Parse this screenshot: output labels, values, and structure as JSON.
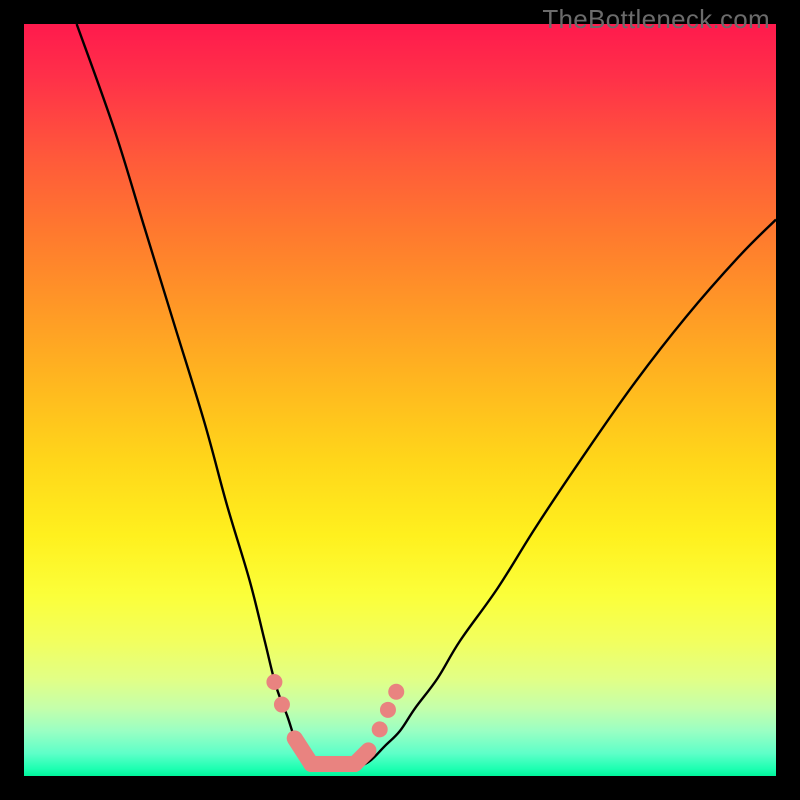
{
  "watermark": "TheBottleneck.com",
  "colors": {
    "gradient_top": "#ff1a4d",
    "gradient_mid": "#ffd61a",
    "gradient_bottom": "#00f59b",
    "curve": "#000000",
    "marker": "#e98380",
    "frame": "#000000"
  },
  "chart_data": {
    "type": "line",
    "title": "",
    "xlabel": "",
    "ylabel": "",
    "xlim": [
      0,
      100
    ],
    "ylim": [
      0,
      100
    ],
    "grid": false,
    "legend": false,
    "series": [
      {
        "name": "left-curve",
        "x": [
          7,
          12,
          16,
          20,
          24,
          27,
          30,
          32,
          33.5,
          35,
          36,
          37,
          38,
          40
        ],
        "y": [
          100,
          86,
          73,
          60,
          47,
          36,
          26,
          18,
          12,
          8,
          5,
          3,
          2,
          1
        ]
      },
      {
        "name": "right-curve",
        "x": [
          44,
          46,
          48,
          50,
          52,
          55,
          58,
          63,
          68,
          74,
          81,
          88,
          95,
          100
        ],
        "y": [
          1,
          2,
          4,
          6,
          9,
          13,
          18,
          25,
          33,
          42,
          52,
          61,
          69,
          74
        ]
      },
      {
        "name": "valley-floor",
        "x": [
          38,
          40,
          42,
          44
        ],
        "y": [
          1.2,
          0.8,
          0.8,
          1.2
        ]
      }
    ],
    "markers": [
      {
        "series": "left-curve",
        "x": 33.3,
        "y": 12.5
      },
      {
        "series": "left-curve",
        "x": 34.3,
        "y": 9.5
      },
      {
        "series": "right-curve",
        "x": 47.3,
        "y": 6.2
      },
      {
        "series": "right-curve",
        "x": 48.4,
        "y": 8.8
      },
      {
        "series": "right-curve",
        "x": 49.5,
        "y": 11.2
      }
    ],
    "highlight_segments": [
      {
        "x0": 36.0,
        "y0": 5.0,
        "x1": 38.2,
        "y1": 1.6
      },
      {
        "x0": 38.2,
        "y0": 1.6,
        "x1": 44.0,
        "y1": 1.6
      },
      {
        "x0": 44.0,
        "y0": 1.6,
        "x1": 45.8,
        "y1": 3.4
      }
    ]
  }
}
